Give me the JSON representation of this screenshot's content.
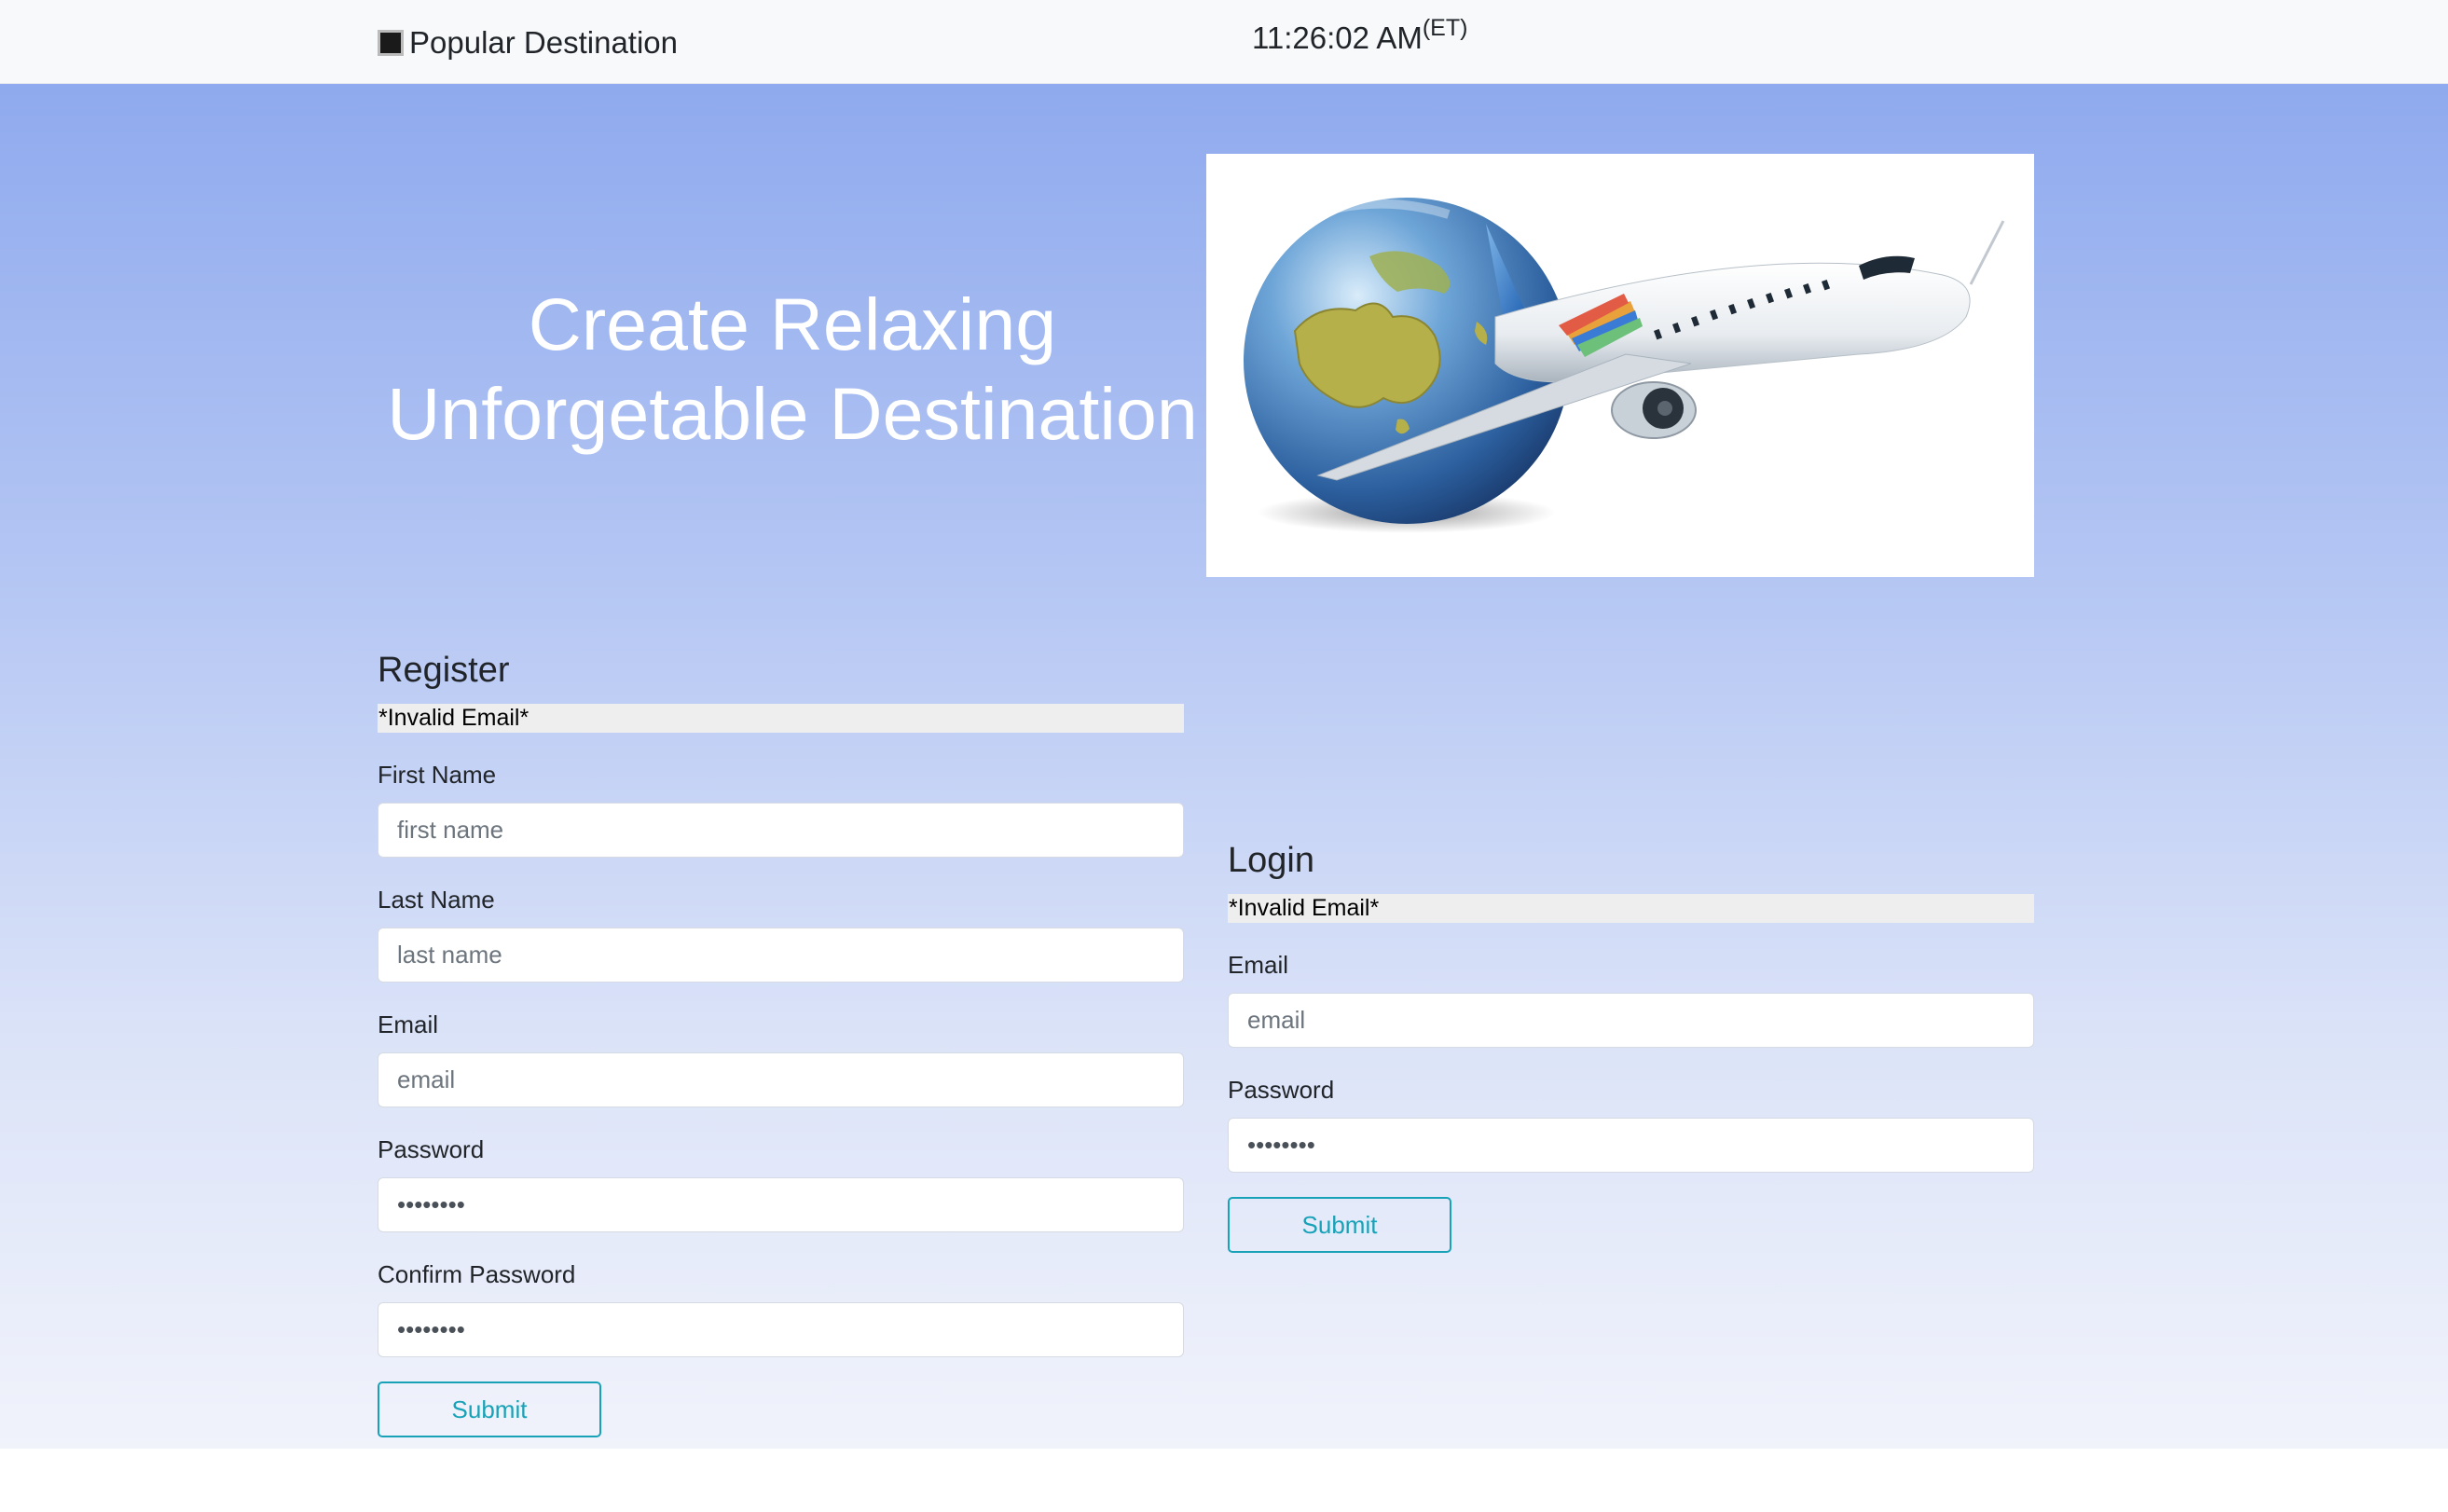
{
  "navbar": {
    "brand": "Popular Destination",
    "time": "11:26:02 AM",
    "timezone": "(ET)"
  },
  "hero": {
    "headline_line1": "Create Relaxing",
    "headline_line2": "Unforgetable Destination"
  },
  "register": {
    "title": "Register",
    "error": "*Invalid Email*",
    "first_name_label": "First Name",
    "first_name_placeholder": "first name",
    "last_name_label": "Last Name",
    "last_name_placeholder": "last name",
    "email_label": "Email",
    "email_placeholder": "email",
    "password_label": "Password",
    "password_value": "password",
    "confirm_label": "Confirm Password",
    "confirm_value": "password",
    "submit": "Submit"
  },
  "login": {
    "title": "Login",
    "error": "*Invalid Email*",
    "email_label": "Email",
    "email_placeholder": "email",
    "password_label": "Password",
    "password_value": "password",
    "submit": "Submit"
  },
  "colors": {
    "accent": "#17a2b8",
    "hero_top": "#8faaee",
    "hero_bottom": "#f1f3fb"
  }
}
